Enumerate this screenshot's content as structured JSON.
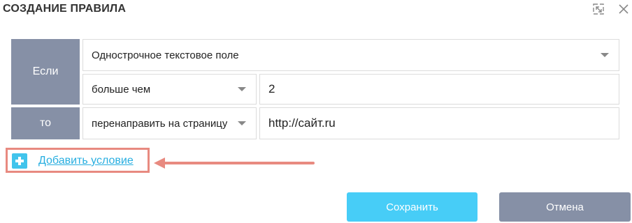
{
  "dialog": {
    "title": "СОЗДАНИЕ ПРАВИЛА"
  },
  "rule": {
    "if_label": "Если",
    "then_label": "то",
    "field_type": "Однострочное текстовое поле",
    "operator": "больше чем",
    "value": "2",
    "action": "перенаправить на страницу",
    "action_url": "http://сайт.ru"
  },
  "add_condition": {
    "label": "Добавить условие"
  },
  "buttons": {
    "save": "Сохранить",
    "cancel": "Отмена"
  },
  "colors": {
    "label_bg": "#8690a6",
    "save_bg": "#47cdf7",
    "link": "#27aee0",
    "highlight": "#e88a80"
  }
}
